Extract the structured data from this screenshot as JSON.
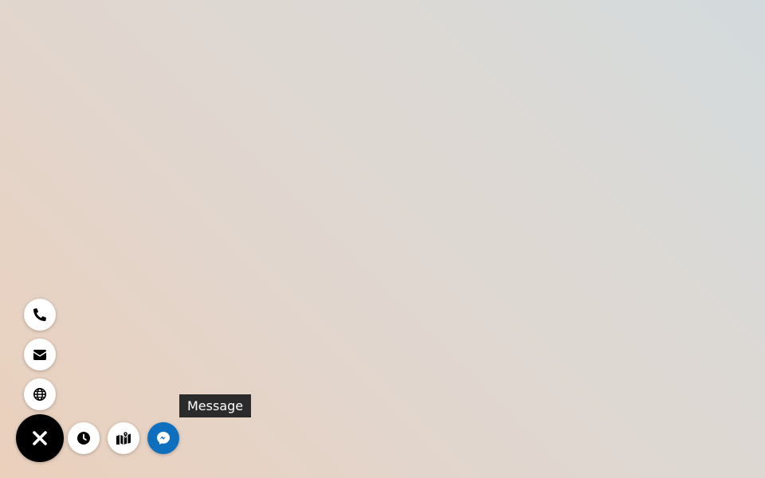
{
  "background": {
    "gradient_colors": [
      "#d3dadd",
      "#dcd9d5",
      "#e1d6ce",
      "#ebd0bc"
    ]
  },
  "contact_widget": {
    "state": "expanded",
    "toggle": {
      "icon": "close-icon",
      "color": "#000000"
    },
    "vertical_buttons": [
      {
        "name": "phone-button",
        "icon": "phone-icon"
      },
      {
        "name": "email-button",
        "icon": "envelope-icon"
      },
      {
        "name": "website-button",
        "icon": "globe-icon"
      }
    ],
    "horizontal_buttons": [
      {
        "name": "hours-button",
        "icon": "clock-icon"
      },
      {
        "name": "map-button",
        "icon": "map-icon"
      },
      {
        "name": "messenger-button",
        "icon": "messenger-icon",
        "color": "#0e6fbf"
      }
    ],
    "tooltip": {
      "text": "Message"
    }
  }
}
